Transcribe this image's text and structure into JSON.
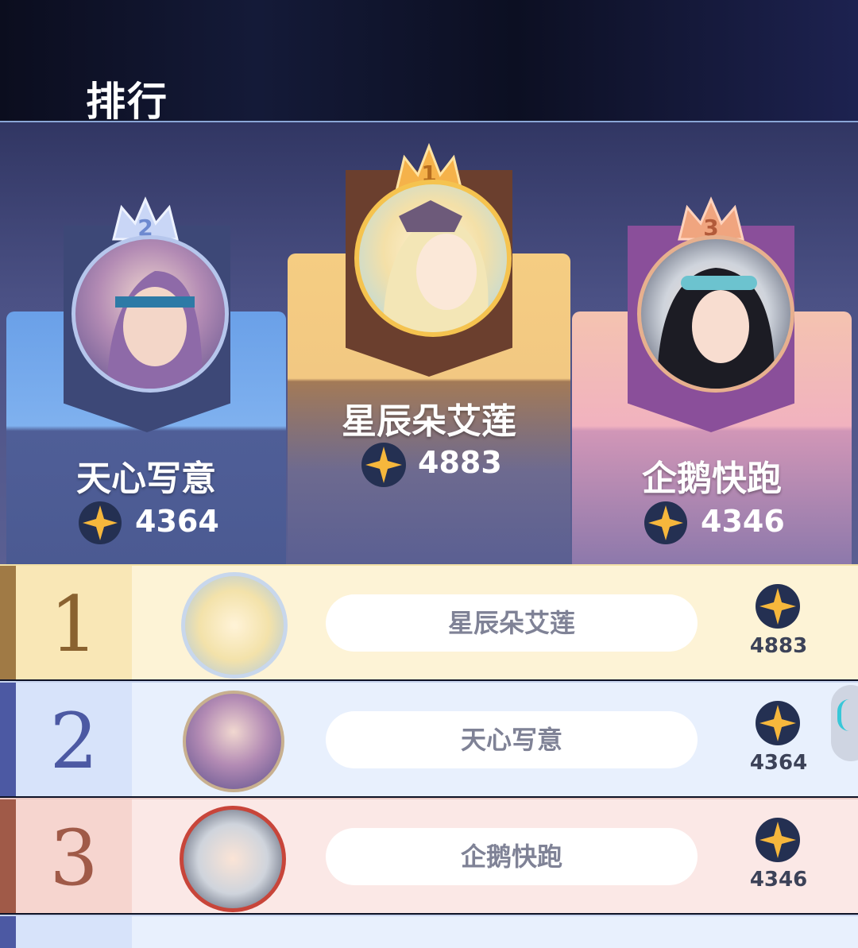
{
  "header": {
    "title": "排行"
  },
  "podium": [
    {
      "rank": "2",
      "name": "天心写意",
      "score": "4364"
    },
    {
      "rank": "1",
      "name": "星辰朵艾莲",
      "score": "4883"
    },
    {
      "rank": "3",
      "name": "企鹅快跑",
      "score": "4346"
    }
  ],
  "rows": [
    {
      "rank": "1",
      "name": "星辰朵艾莲",
      "score": "4883"
    },
    {
      "rank": "2",
      "name": "天心写意",
      "score": "4364"
    },
    {
      "rank": "3",
      "name": "企鹅快跑",
      "score": "4346"
    }
  ],
  "colors": {
    "gold": "#f0b24a",
    "silver": "#8aa6e0",
    "bronze": "#e89a7a",
    "star": "#f5b942"
  }
}
